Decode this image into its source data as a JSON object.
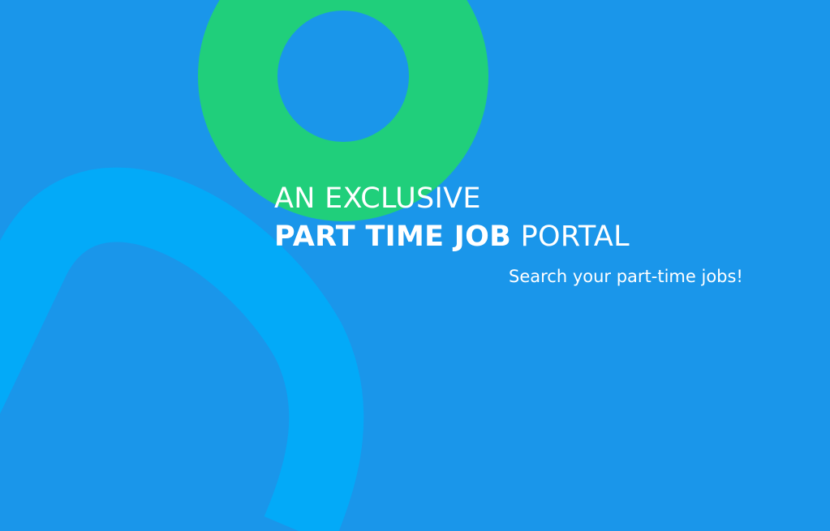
{
  "colors": {
    "background": "#1a96ea",
    "ring": "#20cf7b",
    "arch": "#03aaf8",
    "text": "#ffffff"
  },
  "hero": {
    "headline": {
      "line1": "AN EXCLUSIVE",
      "line2_bold": "PART TIME JOB",
      "line2_light": " PORTAL"
    },
    "tagline": "Search your part-time jobs!"
  }
}
